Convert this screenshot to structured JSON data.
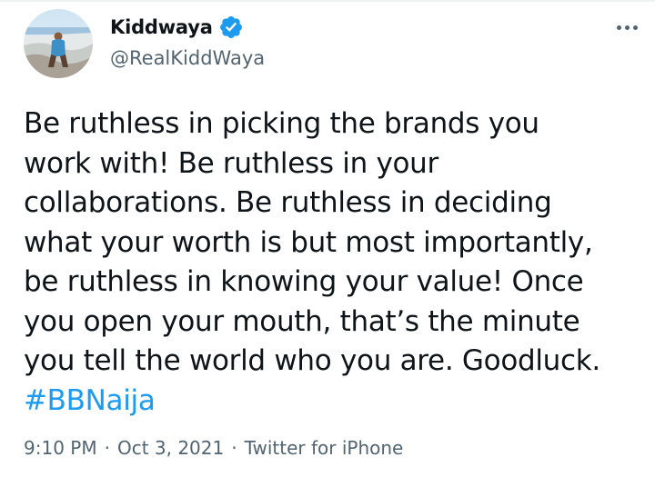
{
  "tweet": {
    "author": {
      "display_name": "Kiddwaya",
      "handle": "@RealKiddWaya",
      "verified": true,
      "verified_icon": "verified-badge-icon",
      "avatar_icon": "avatar-photo"
    },
    "more_icon": "more-options-icon",
    "text_lines": [
      "Be ruthless in picking the brands you",
      "work with! Be ruthless in your",
      "collaborations. Be ruthless in deciding",
      "what your worth is but most importantly,",
      "be ruthless in knowing your value! Once",
      "you open your mouth, that’s the minute",
      "you tell the world who you are. Goodluck."
    ],
    "hashtag": "#BBNaija",
    "time": "9:10 PM",
    "date": "Oct 3, 2021",
    "source": "Twitter for iPhone",
    "separator": "·"
  },
  "colors": {
    "text": "#0f1419",
    "secondary": "#536471",
    "accent": "#1d9bf0",
    "verified": "#1d9bf0"
  }
}
